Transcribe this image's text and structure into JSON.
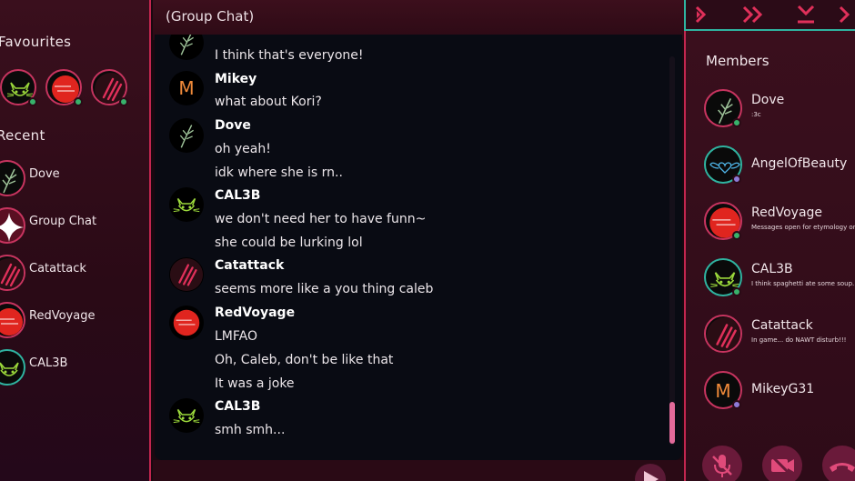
{
  "left": {
    "favourites_title": "Favourites",
    "recent_title": "Recent",
    "recent": [
      "Dove",
      "Group Chat",
      "Catattack",
      "RedVoyage",
      "CAL3B"
    ]
  },
  "chat": {
    "title": "(Group Chat)",
    "messages": [
      {
        "author": "",
        "lines": [
          "I think that's everyone!"
        ]
      },
      {
        "author": "Mikey",
        "lines": [
          "what about Kori?"
        ]
      },
      {
        "author": "Dove",
        "lines": [
          "oh yeah!",
          "idk where she is rn.."
        ]
      },
      {
        "author": "CAL3B",
        "lines": [
          "we don't need her to have funn~",
          "she could be lurking lol"
        ]
      },
      {
        "author": "Catattack",
        "lines": [
          "seems more like a you thing caleb"
        ]
      },
      {
        "author": "RedVoyage",
        "lines": [
          "LMFAO",
          "Oh, Caleb, don't be like that",
          "It was a joke"
        ]
      },
      {
        "author": "CAL3B",
        "lines": [
          "smh smh..."
        ]
      }
    ],
    "mikey_initial": "M"
  },
  "members": {
    "title": "Members",
    "list": [
      {
        "name": "Dove",
        "status": ":3c"
      },
      {
        "name": "AngelOfBeauty",
        "status": ""
      },
      {
        "name": "RedVoyage",
        "status": "Messages open for etymology on"
      },
      {
        "name": "CAL3B",
        "status": "I think spaghetti ate some soup..."
      },
      {
        "name": "Catattack",
        "status": "In game... do NAWT disturb!!!"
      },
      {
        "name": "MikeyG31",
        "status": ""
      }
    ]
  },
  "icons": {
    "controls": [
      "fast-forward-icon",
      "double-chevron-right-icon",
      "download-icon",
      "arrow-right-icon"
    ],
    "call": [
      "mute-mic-icon",
      "video-off-icon",
      "hang-up-icon"
    ]
  },
  "colors": {
    "accent": "#c2264f",
    "teal": "#2fb3a0",
    "online": "#38b26b",
    "idle": "#8d7ad6",
    "scroll": "#e26a9a"
  }
}
